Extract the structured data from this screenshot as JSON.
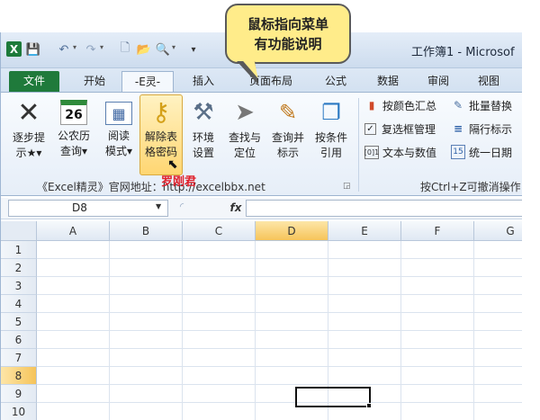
{
  "titlebar": {
    "app_icon": "X",
    "workbook_title": "工作簿1 - Microsof",
    "quick_access": {
      "save_icon": "save-icon",
      "undo_icon": "undo-icon",
      "redo_icon": "redo-icon",
      "new_icon": "new-document-icon",
      "open_icon": "open-folder-icon",
      "print_icon": "print-preview-icon",
      "more": "▾"
    }
  },
  "callout": {
    "line1": "鼠标指向菜单",
    "line2": "有功能说明"
  },
  "tabs": [
    {
      "label": "文件"
    },
    {
      "label": "开始"
    },
    {
      "label": "-E灵-"
    },
    {
      "label": "插入"
    },
    {
      "label": "页面布局"
    },
    {
      "label": "公式"
    },
    {
      "label": "数据"
    },
    {
      "label": "审阅"
    },
    {
      "label": "视图"
    }
  ],
  "ribbon": {
    "buttons": [
      {
        "line1": "逐步提",
        "line2": "示★▾",
        "icon": "close-x-icon",
        "glyph": "✕"
      },
      {
        "line1": "公农历",
        "line2": "查询▾",
        "icon": "calendar-icon",
        "glyph": "26"
      },
      {
        "line1": "阅读",
        "line2": "模式▾",
        "icon": "reading-mode-icon",
        "glyph": "▦"
      },
      {
        "line1": "解除表",
        "line2": "格密码",
        "icon": "key-icon",
        "glyph": "⚷"
      },
      {
        "line1": "环境",
        "line2": "设置",
        "icon": "tools-icon",
        "glyph": "⚒"
      },
      {
        "line1": "查找与",
        "line2": "定位",
        "icon": "pointer-icon",
        "glyph": "➤"
      },
      {
        "line1": "查询并",
        "line2": "标示",
        "icon": "edit-mark-icon",
        "glyph": "✎"
      },
      {
        "line1": "按条件",
        "line2": "引用",
        "icon": "reference-icon",
        "glyph": "❐"
      }
    ],
    "overlay_name": "罗刚君",
    "group_label": "《Excel精灵》官网地址：http://excelbbx.net",
    "right_buttons": [
      {
        "label": "按颜色汇总",
        "icon": "color-summary-icon",
        "glyph": "▮"
      },
      {
        "label": "复选框管理",
        "icon": "checkbox-icon",
        "glyph": "✓"
      },
      {
        "label": "文本与数值",
        "icon": "text-number-icon",
        "glyph": "[0]1"
      },
      {
        "label": "批量替换",
        "icon": "batch-replace-icon",
        "glyph": "✎"
      },
      {
        "label": "隔行标示",
        "icon": "alternate-rows-icon",
        "glyph": "≡"
      },
      {
        "label": "统一日期",
        "icon": "unify-date-icon",
        "glyph": "15"
      }
    ],
    "group2_label": "按Ctrl+Z可撤消操作"
  },
  "formula_bar": {
    "name_box": "D8",
    "fx": "fx",
    "value": ""
  },
  "grid": {
    "columns": [
      "A",
      "B",
      "C",
      "D",
      "E",
      "F",
      "G"
    ],
    "rows": [
      "1",
      "2",
      "3",
      "4",
      "5",
      "6",
      "7",
      "8",
      "9",
      "10"
    ],
    "selected_column": "D",
    "selected_row": "8",
    "active_cell": "D8"
  }
}
